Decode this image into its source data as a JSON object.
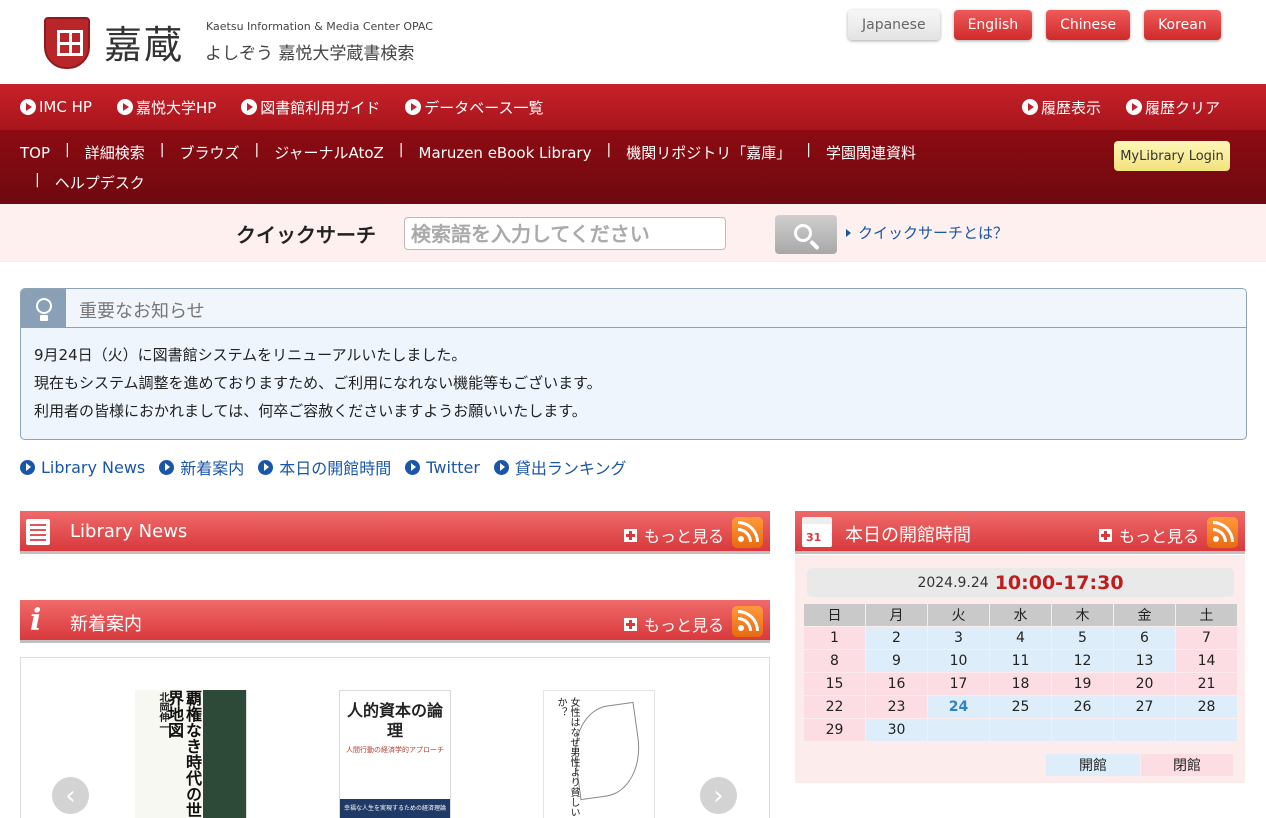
{
  "header": {
    "logo_main": "嘉蔵",
    "logo_sub1": "Kaetsu Information & Media Center OPAC",
    "logo_sub2": "よしぞう 嘉悦大学蔵書検索",
    "languages": [
      "Japanese",
      "English",
      "Chinese",
      "Korean"
    ],
    "active_language": "Japanese"
  },
  "nav1": {
    "left": [
      "IMC HP",
      "嘉悦大学HP",
      "図書館利用ガイド",
      "データベース一覧"
    ],
    "right": [
      "履歴表示",
      "履歴クリア"
    ]
  },
  "nav2": {
    "links": [
      "TOP",
      "詳細検索",
      "ブラウズ",
      "ジャーナルAtoZ",
      "Maruzen eBook Library",
      "機関リポジトリ「嘉庫」",
      "学園関連資料",
      "ヘルプデスク"
    ],
    "mylibrary_label": "MyLibrary Login"
  },
  "quick_search": {
    "label": "クイックサーチ",
    "placeholder": "検索語を入力してください",
    "help_link": "クイックサーチとは？"
  },
  "notice": {
    "title": "重要なお知らせ",
    "lines": [
      "9月24日（火）に図書館システムをリニューアルいたしました。",
      "現在もシステム調整を進めておりますため、ご利用になれない機能等もございます。",
      "利用者の皆様におかれましては、何卒ご容赦くださいますようお願いいたします。"
    ]
  },
  "quick_links": [
    "Library News",
    "新着案内",
    "本日の開館時間",
    "Twitter",
    "貸出ランキング"
  ],
  "sections": {
    "news": {
      "title": "Library News",
      "more": "もっと見る"
    },
    "new_arrivals": {
      "title": "新着案内",
      "more": "もっと見る"
    },
    "hours": {
      "title": "本日の開館時間",
      "more": "もっと見る"
    }
  },
  "books": [
    {
      "title": "覇権なき時代の世界地図",
      "author": "北岡伸一"
    },
    {
      "title": "人的資本の論理",
      "subtitle": "人間行動の経済学的アプローチ",
      "band": "幸福な人生を実現するための経済理論"
    },
    {
      "title": "女性はなぜ男性より貧しいのか？"
    }
  ],
  "calendar": {
    "date": "2024.9.24",
    "hours": "10:00-17:30",
    "weekdays": [
      "日",
      "月",
      "火",
      "水",
      "木",
      "金",
      "土"
    ],
    "weeks": [
      [
        "1",
        "2",
        "3",
        "4",
        "5",
        "6",
        "7"
      ],
      [
        "8",
        "9",
        "10",
        "11",
        "12",
        "13",
        "14"
      ],
      [
        "15",
        "16",
        "17",
        "18",
        "19",
        "20",
        "21"
      ],
      [
        "22",
        "23",
        "24",
        "25",
        "26",
        "27",
        "28"
      ],
      [
        "29",
        "30",
        "",
        "",
        "",
        "",
        ""
      ]
    ],
    "today": "24",
    "legend_open": "開館",
    "legend_closed": "閉館"
  }
}
